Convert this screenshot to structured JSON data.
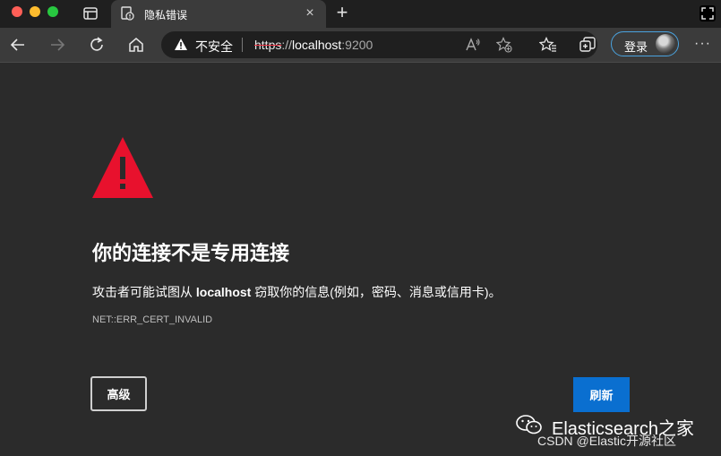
{
  "window": {
    "tab": {
      "title": "隐私错误",
      "close": "×"
    },
    "new_tab": "+"
  },
  "toolbar": {
    "address": {
      "security_label": "不安全",
      "url_scheme": "https",
      "url_sep": "://",
      "url_host": "localhost",
      "url_port": ":9200"
    },
    "login_label": "登录",
    "more": "···"
  },
  "page": {
    "headline": "你的连接不是专用连接",
    "description_before": "攻击者可能试图从 ",
    "description_host": "localhost",
    "description_after": " 窃取你的信息(例如，密码、消息或信用卡)。",
    "error_code": "NET::ERR_CERT_INVALID",
    "advanced_button": "高级",
    "refresh_button": "刷新"
  },
  "watermark": {
    "title": "Elasticsearch之家",
    "subtitle": "CSDN @Elastic开源社区"
  },
  "colors": {
    "background": "#2b2b2b",
    "warning_red": "#e8112d",
    "refresh_blue": "#0a6fd0",
    "login_border": "#4aa3df"
  }
}
